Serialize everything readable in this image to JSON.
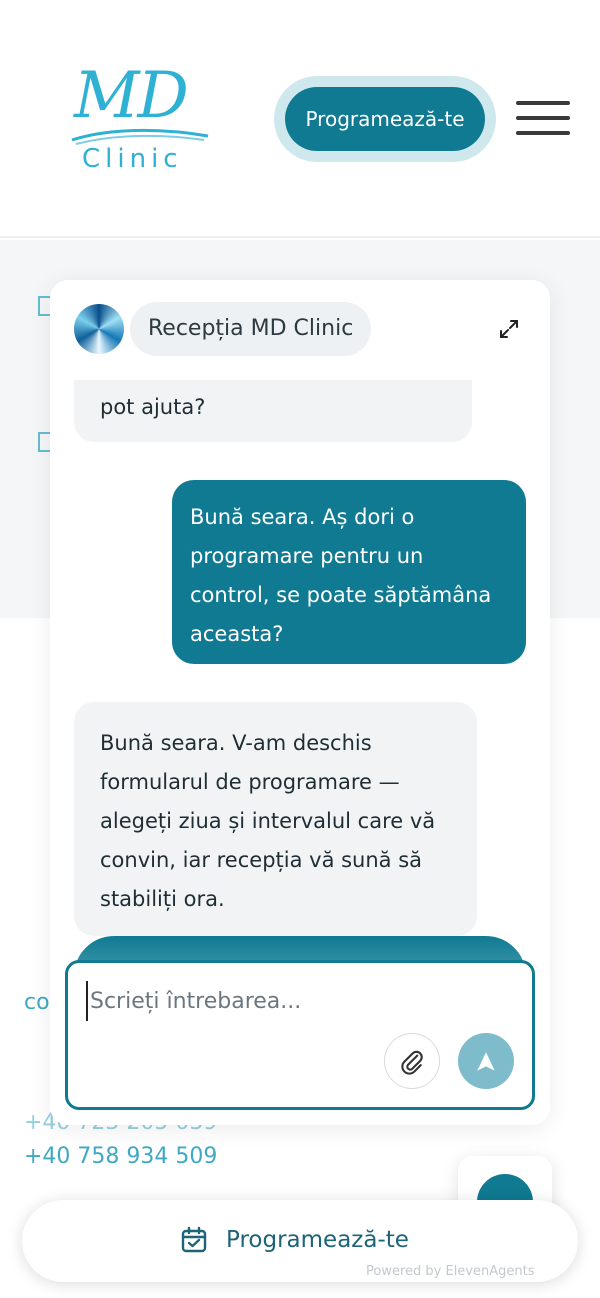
{
  "header": {
    "logo_md": "MD",
    "logo_clinic": "Clinic",
    "book_button": "Programează-te"
  },
  "background": {
    "fragment_co": "co",
    "phone_partial": "+40 723 205 039",
    "phone": "+40 758 934 509"
  },
  "chat": {
    "title": "Recepția MD Clinic",
    "messages": [
      {
        "role": "assistant",
        "text": "pot ajuta?"
      },
      {
        "role": "user",
        "text": "Bună seara. Aș dori o programare pentru un control, se poate săptămâna aceasta?"
      },
      {
        "role": "assistant",
        "text": "Bună seara. V-am deschis formularul de programare — alegeți ziua și intervalul care vă convin, iar recepția vă sună să stabiliți ora."
      }
    ],
    "input_placeholder": "Scrieți întrebarea...",
    "input_value": ""
  },
  "bottom_bar": {
    "label": "Programează-te",
    "powered_by": "Powered by ElevenAgents"
  },
  "colors": {
    "accent": "#0f7a92",
    "logo": "#2fb1d3",
    "send_disabled": "#7fbccb"
  },
  "icons": {
    "expand": "expand-icon",
    "attach": "paperclip-icon",
    "send": "send-icon",
    "scroll_down": "chevron-down-icon",
    "calendar": "calendar-icon",
    "menu": "hamburger-icon"
  }
}
